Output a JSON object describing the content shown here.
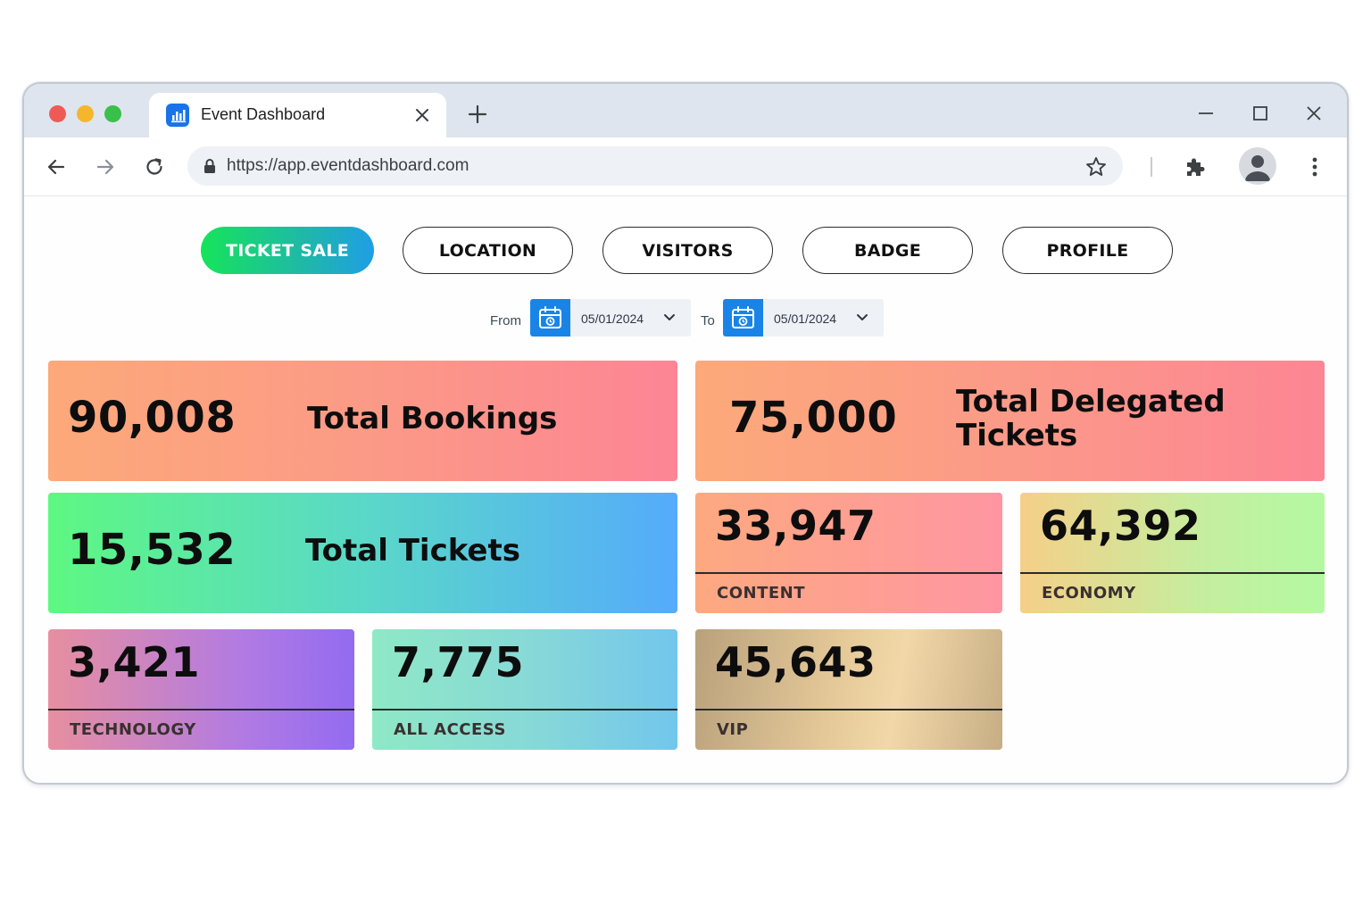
{
  "browser": {
    "tab_title": "Event Dashboard",
    "url": "https://app.eventdashboard.com"
  },
  "nav_pills": [
    {
      "label": "TICKET SALE",
      "active": true
    },
    {
      "label": "LOCATION",
      "active": false
    },
    {
      "label": "VISITORS",
      "active": false
    },
    {
      "label": "BADGE",
      "active": false
    },
    {
      "label": "PROFILE",
      "active": false
    }
  ],
  "date_filter": {
    "from_label": "From",
    "from_date": "05/01/2024",
    "to_label": "To",
    "to_date": "05/01/2024"
  },
  "stats": {
    "total_bookings": {
      "value": "90,008",
      "label": "Total Bookings"
    },
    "total_delegated": {
      "value": "75,000",
      "label_line1": "Total Delegated",
      "label_line2": "Tickets"
    },
    "total_tickets": {
      "value": "15,532",
      "label": "Total Tickets"
    },
    "content": {
      "value": "33,947",
      "label": "CONTENT"
    },
    "economy": {
      "value": "64,392",
      "label": "ECONOMY"
    },
    "technology": {
      "value": "3,421",
      "label": "TECHNOLOGY"
    },
    "all_access": {
      "value": "7,775",
      "label": "ALL ACCESS"
    },
    "vip": {
      "value": "45,643",
      "label": "VIP"
    }
  },
  "colors": {
    "accent_blue": "#1a84e6",
    "active_pill_start": "#16e45a",
    "active_pill_end": "#1f9ee6"
  }
}
